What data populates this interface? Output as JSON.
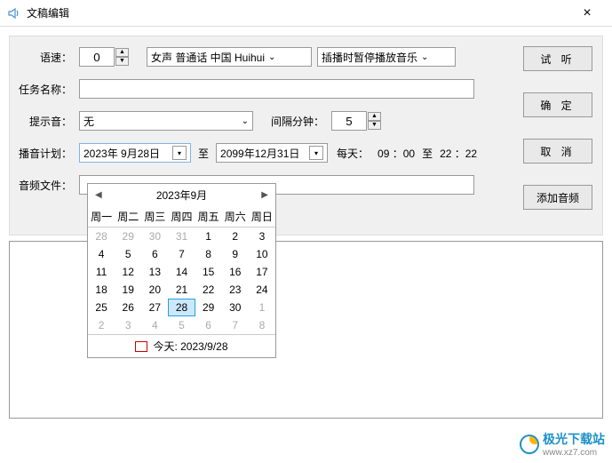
{
  "window": {
    "title": "文稿编辑",
    "close": "×"
  },
  "labels": {
    "speed": "语速：",
    "taskName": "任务名称：",
    "alertSound": "提示音：",
    "intervalMin": "间隔分钟：",
    "broadcastPlan": "播音计划：",
    "to": "至",
    "daily": "每天：",
    "timeTo": "至",
    "audioFile": "音频文件："
  },
  "fields": {
    "speed": "0",
    "voice": "女声 普通话 中国 Huihui",
    "pause": "插播时暂停播放音乐",
    "taskName": "",
    "alertSound": "无",
    "intervalMin": "5",
    "startDate": "2023年 9月28日",
    "endDate": "2099年12月31日",
    "time1": "09 ：00",
    "time2": "22 ：22",
    "audioFile": ""
  },
  "buttons": {
    "preview": "试 听",
    "ok": "确 定",
    "cancel": "取 消",
    "addAudio": "添加音频"
  },
  "calendar": {
    "month": "2023年9月",
    "prev": "◀",
    "next": "▶",
    "dayHeaders": [
      "周一",
      "周二",
      "周三",
      "周四",
      "周五",
      "周六",
      "周日"
    ],
    "weeks": [
      [
        {
          "d": "28",
          "dim": true
        },
        {
          "d": "29",
          "dim": true
        },
        {
          "d": "30",
          "dim": true
        },
        {
          "d": "31",
          "dim": true
        },
        {
          "d": "1"
        },
        {
          "d": "2"
        },
        {
          "d": "3"
        }
      ],
      [
        {
          "d": "4"
        },
        {
          "d": "5"
        },
        {
          "d": "6"
        },
        {
          "d": "7"
        },
        {
          "d": "8"
        },
        {
          "d": "9"
        },
        {
          "d": "10"
        }
      ],
      [
        {
          "d": "11"
        },
        {
          "d": "12"
        },
        {
          "d": "13"
        },
        {
          "d": "14"
        },
        {
          "d": "15"
        },
        {
          "d": "16"
        },
        {
          "d": "17"
        }
      ],
      [
        {
          "d": "18"
        },
        {
          "d": "19"
        },
        {
          "d": "20"
        },
        {
          "d": "21"
        },
        {
          "d": "22"
        },
        {
          "d": "23"
        },
        {
          "d": "24"
        }
      ],
      [
        {
          "d": "25"
        },
        {
          "d": "26"
        },
        {
          "d": "27"
        },
        {
          "d": "28",
          "sel": true
        },
        {
          "d": "29"
        },
        {
          "d": "30"
        },
        {
          "d": "1",
          "dim": true
        }
      ],
      [
        {
          "d": "2",
          "dim": true
        },
        {
          "d": "3",
          "dim": true
        },
        {
          "d": "4",
          "dim": true
        },
        {
          "d": "5",
          "dim": true
        },
        {
          "d": "6",
          "dim": true
        },
        {
          "d": "7",
          "dim": true
        },
        {
          "d": "8",
          "dim": true
        }
      ]
    ],
    "today": "今天: 2023/9/28"
  },
  "watermark": {
    "name": "极光下载站",
    "url": "www.xz7.com"
  }
}
